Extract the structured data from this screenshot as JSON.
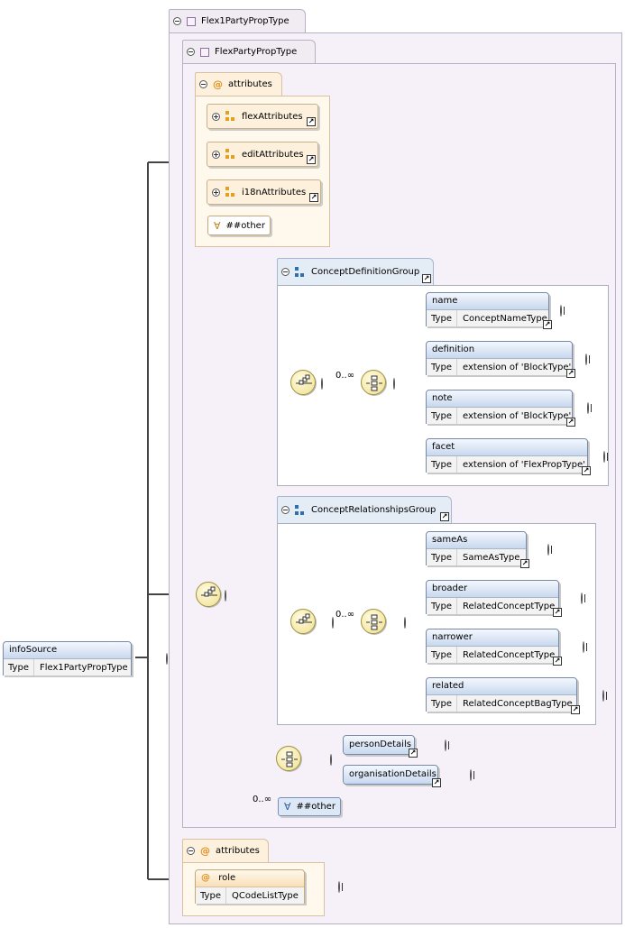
{
  "root_element": {
    "name": "infoSource",
    "type_label": "Type",
    "type_value": "Flex1PartyPropType"
  },
  "outer_type": {
    "name": "Flex1PartyPropType"
  },
  "inner_type": {
    "name": "FlexPartyPropType"
  },
  "inner_attributes": {
    "label": "attributes",
    "groups": [
      {
        "name": "flexAttributes"
      },
      {
        "name": "editAttributes"
      },
      {
        "name": "i18nAttributes"
      }
    ],
    "any_attribute": "##other"
  },
  "concept_definition_group": {
    "name": "ConceptDefinitionGroup",
    "occurrence": "0..∞",
    "elements": [
      {
        "name": "name",
        "type_label": "Type",
        "type_value": "ConceptNameType"
      },
      {
        "name": "definition",
        "type_label": "Type",
        "type_value": "extension of 'BlockType'"
      },
      {
        "name": "note",
        "type_label": "Type",
        "type_value": "extension of 'BlockType'"
      },
      {
        "name": "facet",
        "type_label": "Type",
        "type_value": "extension of 'FlexPropType'"
      }
    ]
  },
  "concept_relationships_group": {
    "name": "ConceptRelationshipsGroup",
    "occurrence": "0..∞",
    "elements": [
      {
        "name": "sameAs",
        "type_label": "Type",
        "type_value": "SameAsType"
      },
      {
        "name": "broader",
        "type_label": "Type",
        "type_value": "RelatedConceptType"
      },
      {
        "name": "narrower",
        "type_label": "Type",
        "type_value": "RelatedConceptType"
      },
      {
        "name": "related",
        "type_label": "Type",
        "type_value": "RelatedConceptBagType"
      }
    ]
  },
  "choice_elements": [
    {
      "name": "personDetails"
    },
    {
      "name": "organisationDetails"
    }
  ],
  "any_element": {
    "occurrence": "0..∞",
    "label": "##other"
  },
  "outer_attributes": {
    "label": "attributes",
    "role": {
      "name": "role",
      "type_label": "Type",
      "type_value": "QCodeListType"
    }
  },
  "colors": {
    "connector": "#444444",
    "thin_connector": "#c0c0c0",
    "element_header": "#c8d8ee"
  }
}
